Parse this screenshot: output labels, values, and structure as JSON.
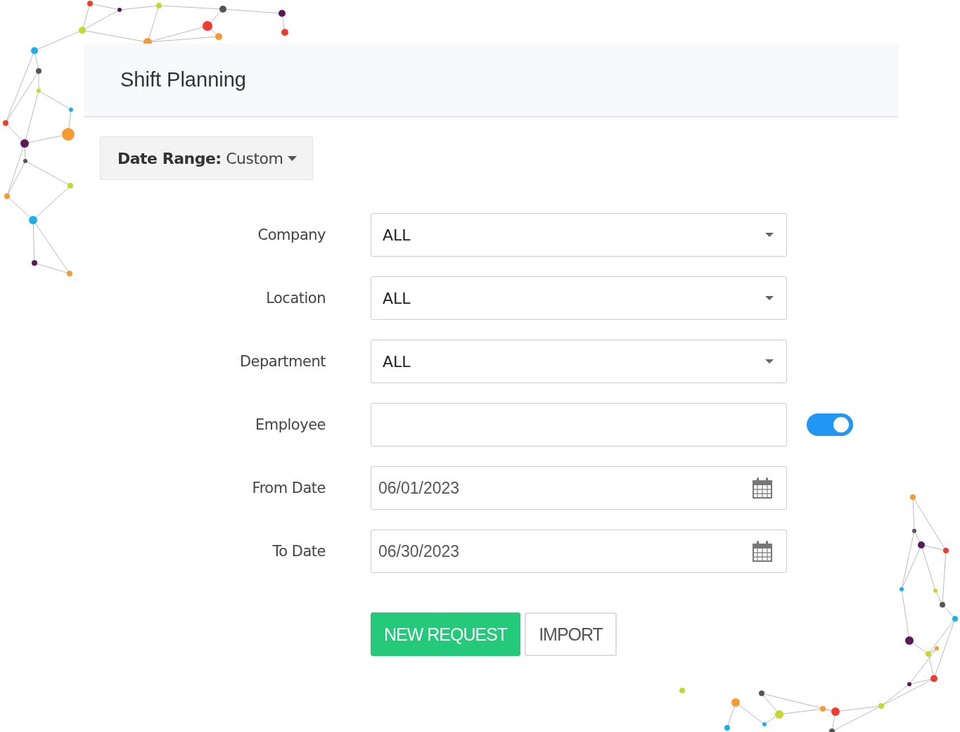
{
  "header": {
    "title": "Shift Planning"
  },
  "date_range": {
    "label": "Date Range:",
    "value": "Custom"
  },
  "fields": [
    {
      "kind": "select",
      "label": "Company",
      "value": "ALL"
    },
    {
      "kind": "select",
      "label": "Location",
      "value": "ALL"
    },
    {
      "kind": "select",
      "label": "Department",
      "value": "ALL"
    },
    {
      "kind": "text",
      "label": "Employee",
      "toggle_on": true
    },
    {
      "kind": "date",
      "label": "From Date",
      "value": "06/01/2023"
    },
    {
      "kind": "date",
      "label": "To Date",
      "value": "06/30/2023"
    }
  ],
  "buttons": [
    {
      "kind": "primary",
      "label": "NEW REQUEST"
    },
    {
      "kind": "secondary",
      "label": "IMPORT"
    }
  ]
}
